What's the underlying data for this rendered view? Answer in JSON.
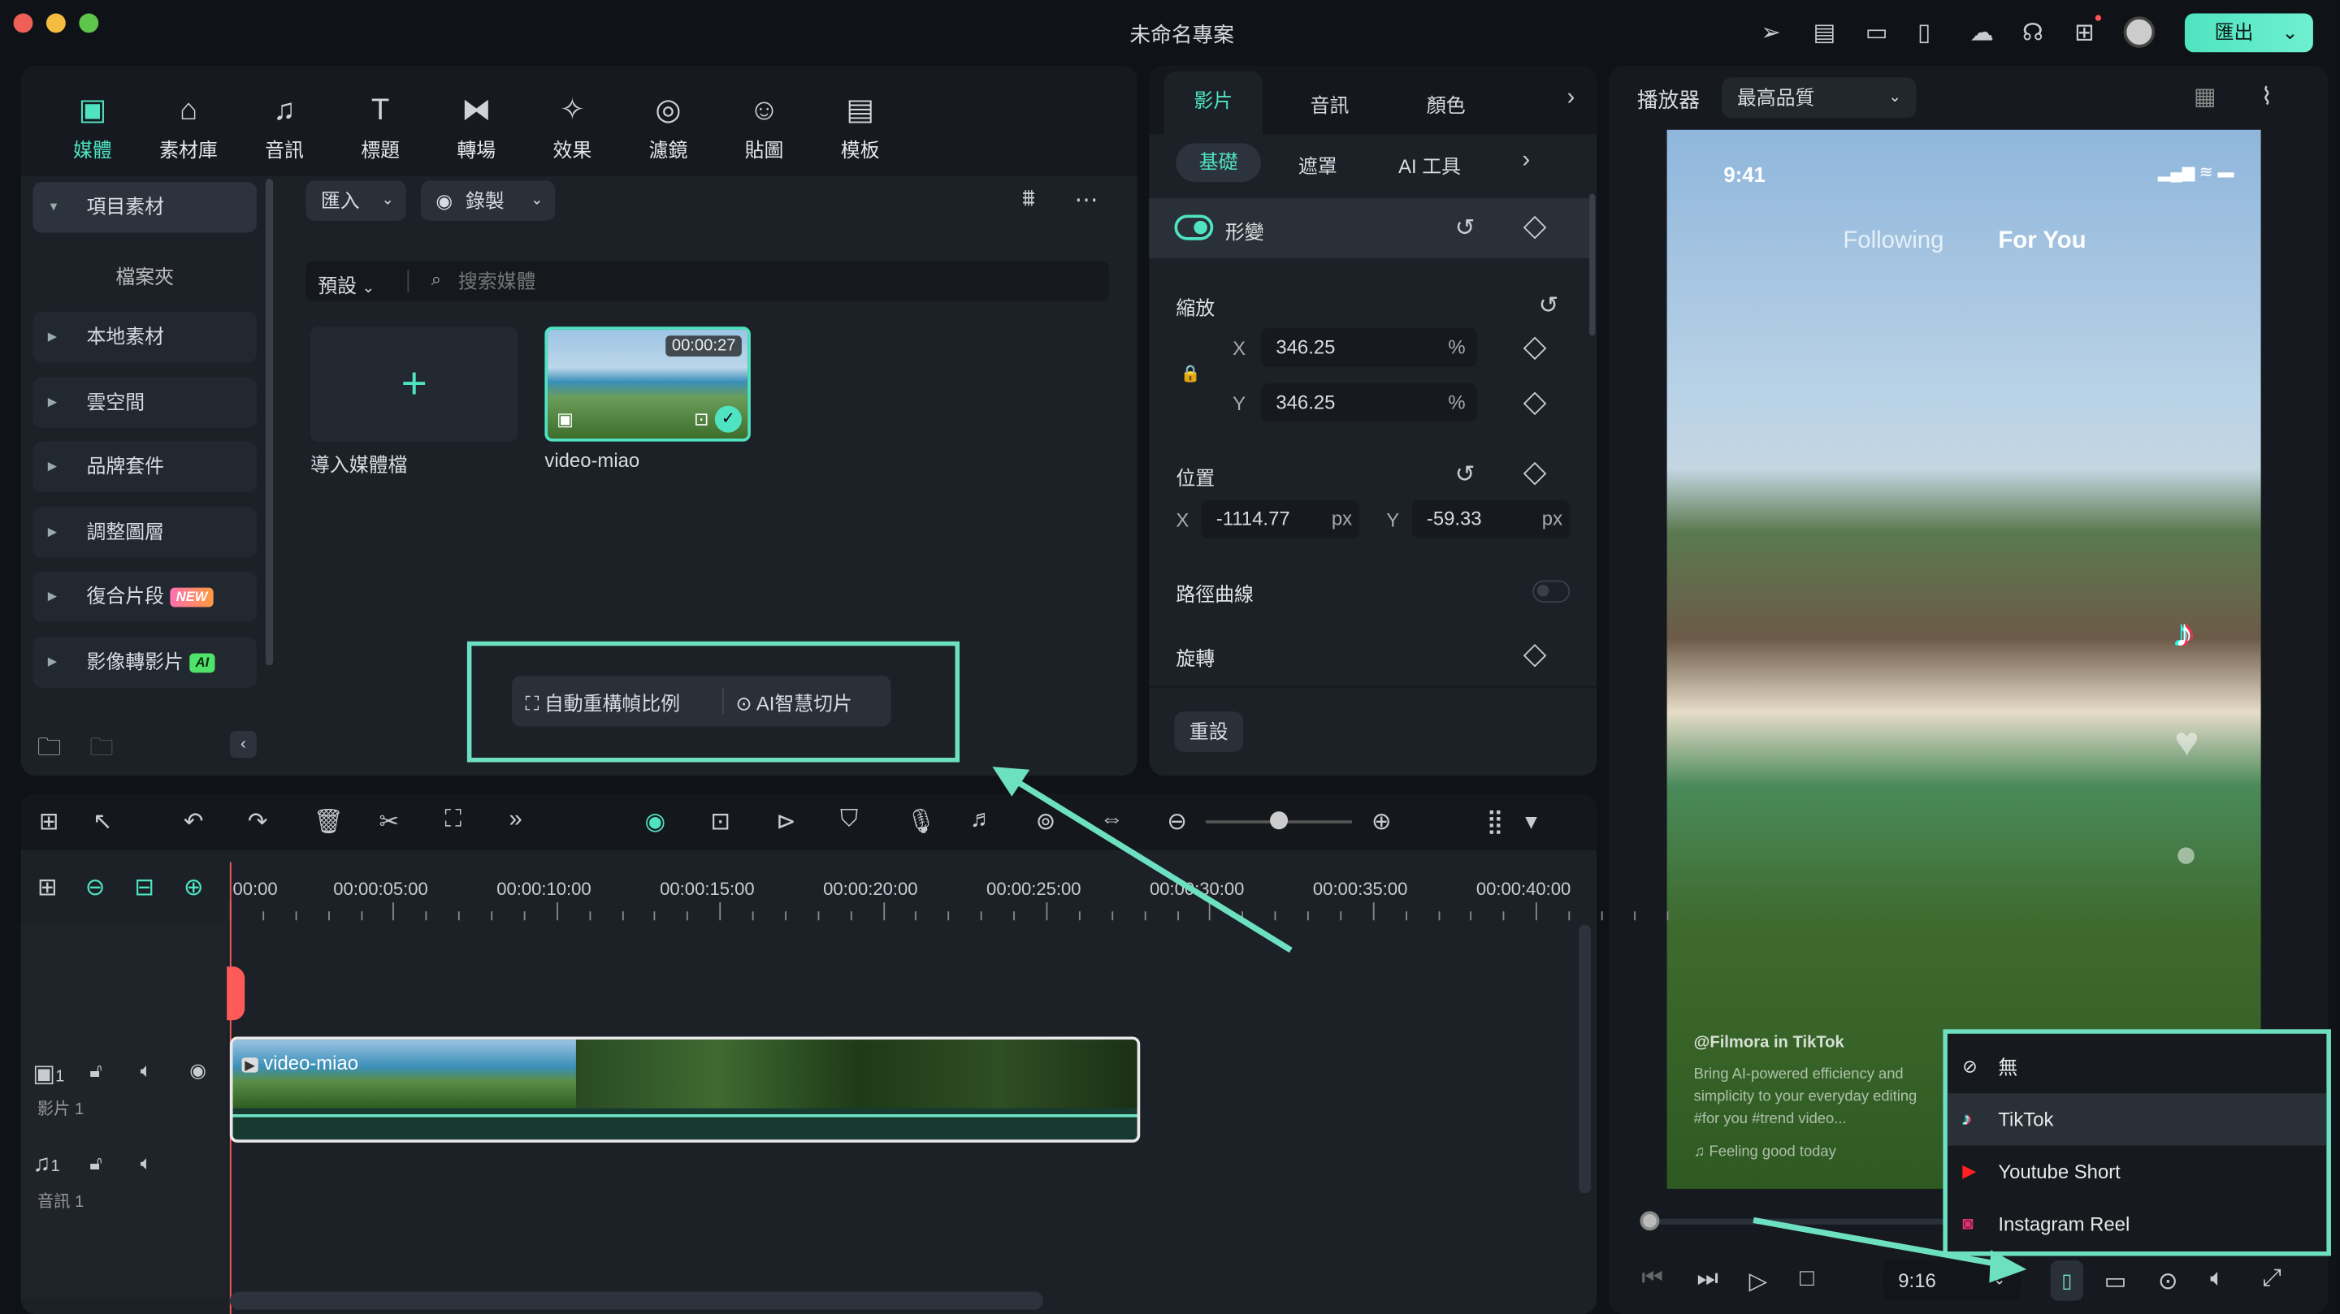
{
  "window": {
    "title": "未命名專案",
    "export_label": "匯出"
  },
  "toolbar": [
    {
      "label": "媒體",
      "icon": "media-icon",
      "glyph": "▣"
    },
    {
      "label": "素材庫",
      "icon": "stock-icon",
      "glyph": "⌂"
    },
    {
      "label": "音訊",
      "icon": "music-icon",
      "glyph": "♫"
    },
    {
      "label": "標題",
      "icon": "title-icon",
      "glyph": "T"
    },
    {
      "label": "轉場",
      "icon": "transition-icon",
      "glyph": "⧓"
    },
    {
      "label": "效果",
      "icon": "effects-icon",
      "glyph": "✧"
    },
    {
      "label": "濾鏡",
      "icon": "filter-icon",
      "glyph": "◎"
    },
    {
      "label": "貼圖",
      "icon": "sticker-icon",
      "glyph": "☺"
    },
    {
      "label": "模板",
      "icon": "template-icon",
      "glyph": "▤"
    }
  ],
  "sidebar": {
    "items": [
      {
        "label": "項目素材"
      },
      {
        "label": "檔案夾"
      },
      {
        "label": "本地素材"
      },
      {
        "label": "雲空間"
      },
      {
        "label": "品牌套件"
      },
      {
        "label": "調整圖層"
      },
      {
        "label": "復合片段",
        "badge": "NEW"
      },
      {
        "label": "影像轉影片",
        "badge": "AI"
      }
    ]
  },
  "media": {
    "import_label": "匯入",
    "record_label": "錄製",
    "sort_label": "預設",
    "search_placeholder": "搜索媒體",
    "import_tile_label": "導入媒體檔",
    "clip": {
      "name": "video-miao",
      "duration": "00:00:27"
    },
    "auto_reframe_label": "自動重構幀比例",
    "ai_cut_label": "AI智慧切片"
  },
  "properties": {
    "tabs": [
      "影片",
      "音訊",
      "顏色"
    ],
    "subtabs": [
      "基礎",
      "遮罩",
      "AI 工具"
    ],
    "transform_label": "形變",
    "transform_on": true,
    "scale_label": "縮放",
    "scale_x": "346.25",
    "scale_y": "346.25",
    "percent": "%",
    "position_label": "位置",
    "pos_x": "-1114.77",
    "pos_y": "-59.33",
    "px": "px",
    "x": "X",
    "y": "Y",
    "path_label": "路徑曲線",
    "path_on": false,
    "rotate_label": "旋轉",
    "reset_label": "重設"
  },
  "player": {
    "label": "播放器",
    "quality": "最高品質",
    "phone_time": "9:41",
    "following": "Following",
    "for_you": "For You",
    "caption_user": "@Filmora in TikTok",
    "caption_text1": "Bring AI-powered efficiency and",
    "caption_text2": "simplicity to your everyday editing",
    "caption_tags": "#for you #trend video...",
    "caption_music": "♫ Feeling good today",
    "ratio": "9:16",
    "progress": 0
  },
  "safe_zone_menu": {
    "items": [
      {
        "label": "無",
        "icon": "none-icon"
      },
      {
        "label": "TikTok",
        "icon": "tiktok-icon",
        "selected": true
      },
      {
        "label": "Youtube Short",
        "icon": "youtube-shorts-icon"
      },
      {
        "label": "Instagram Reel",
        "icon": "instagram-icon"
      }
    ]
  },
  "timeline": {
    "ruler": [
      "00:00",
      "00:00:05:00",
      "00:00:10:00",
      "00:00:15:00",
      "00:00:20:00",
      "00:00:25:00",
      "00:00:30:00",
      "00:00:35:00",
      "00:00:40:00"
    ],
    "video_track": {
      "num": "1",
      "name": "影片 1"
    },
    "audio_track": {
      "num": "1",
      "name": "音訊 1"
    },
    "clip_name": "video-miao"
  },
  "colors": {
    "accent": "#4fe3c1",
    "highlight": "#6ee0c2",
    "playhead": "#ff5a5a"
  }
}
